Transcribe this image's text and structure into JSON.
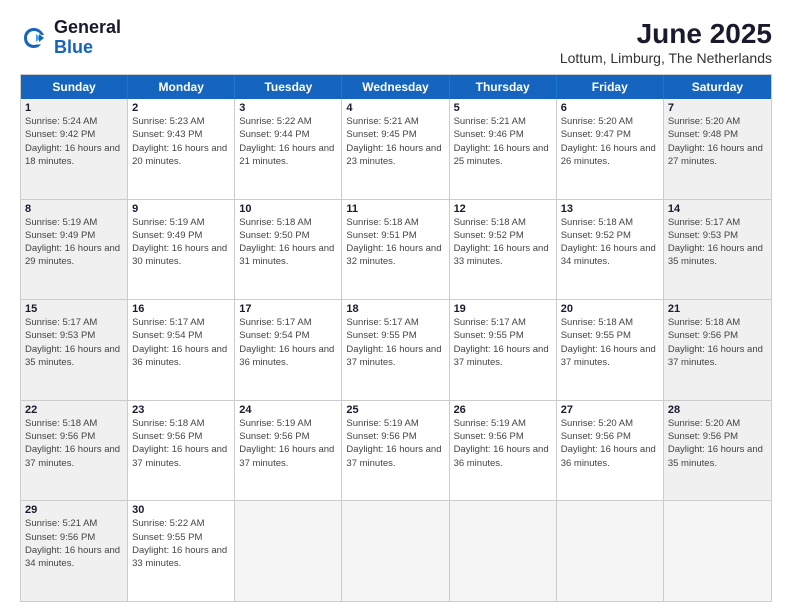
{
  "logo": {
    "general": "General",
    "blue": "Blue"
  },
  "title": "June 2025",
  "location": "Lottum, Limburg, The Netherlands",
  "days_of_week": [
    "Sunday",
    "Monday",
    "Tuesday",
    "Wednesday",
    "Thursday",
    "Friday",
    "Saturday"
  ],
  "weeks": [
    [
      {
        "day": 1,
        "sunrise": "Sunrise: 5:24 AM",
        "sunset": "Sunset: 9:42 PM",
        "daylight": "Daylight: 16 hours and 18 minutes."
      },
      {
        "day": 2,
        "sunrise": "Sunrise: 5:23 AM",
        "sunset": "Sunset: 9:43 PM",
        "daylight": "Daylight: 16 hours and 20 minutes."
      },
      {
        "day": 3,
        "sunrise": "Sunrise: 5:22 AM",
        "sunset": "Sunset: 9:44 PM",
        "daylight": "Daylight: 16 hours and 21 minutes."
      },
      {
        "day": 4,
        "sunrise": "Sunrise: 5:21 AM",
        "sunset": "Sunset: 9:45 PM",
        "daylight": "Daylight: 16 hours and 23 minutes."
      },
      {
        "day": 5,
        "sunrise": "Sunrise: 5:21 AM",
        "sunset": "Sunset: 9:46 PM",
        "daylight": "Daylight: 16 hours and 25 minutes."
      },
      {
        "day": 6,
        "sunrise": "Sunrise: 5:20 AM",
        "sunset": "Sunset: 9:47 PM",
        "daylight": "Daylight: 16 hours and 26 minutes."
      },
      {
        "day": 7,
        "sunrise": "Sunrise: 5:20 AM",
        "sunset": "Sunset: 9:48 PM",
        "daylight": "Daylight: 16 hours and 27 minutes."
      }
    ],
    [
      {
        "day": 8,
        "sunrise": "Sunrise: 5:19 AM",
        "sunset": "Sunset: 9:49 PM",
        "daylight": "Daylight: 16 hours and 29 minutes."
      },
      {
        "day": 9,
        "sunrise": "Sunrise: 5:19 AM",
        "sunset": "Sunset: 9:49 PM",
        "daylight": "Daylight: 16 hours and 30 minutes."
      },
      {
        "day": 10,
        "sunrise": "Sunrise: 5:18 AM",
        "sunset": "Sunset: 9:50 PM",
        "daylight": "Daylight: 16 hours and 31 minutes."
      },
      {
        "day": 11,
        "sunrise": "Sunrise: 5:18 AM",
        "sunset": "Sunset: 9:51 PM",
        "daylight": "Daylight: 16 hours and 32 minutes."
      },
      {
        "day": 12,
        "sunrise": "Sunrise: 5:18 AM",
        "sunset": "Sunset: 9:52 PM",
        "daylight": "Daylight: 16 hours and 33 minutes."
      },
      {
        "day": 13,
        "sunrise": "Sunrise: 5:18 AM",
        "sunset": "Sunset: 9:52 PM",
        "daylight": "Daylight: 16 hours and 34 minutes."
      },
      {
        "day": 14,
        "sunrise": "Sunrise: 5:17 AM",
        "sunset": "Sunset: 9:53 PM",
        "daylight": "Daylight: 16 hours and 35 minutes."
      }
    ],
    [
      {
        "day": 15,
        "sunrise": "Sunrise: 5:17 AM",
        "sunset": "Sunset: 9:53 PM",
        "daylight": "Daylight: 16 hours and 35 minutes."
      },
      {
        "day": 16,
        "sunrise": "Sunrise: 5:17 AM",
        "sunset": "Sunset: 9:54 PM",
        "daylight": "Daylight: 16 hours and 36 minutes."
      },
      {
        "day": 17,
        "sunrise": "Sunrise: 5:17 AM",
        "sunset": "Sunset: 9:54 PM",
        "daylight": "Daylight: 16 hours and 36 minutes."
      },
      {
        "day": 18,
        "sunrise": "Sunrise: 5:17 AM",
        "sunset": "Sunset: 9:55 PM",
        "daylight": "Daylight: 16 hours and 37 minutes."
      },
      {
        "day": 19,
        "sunrise": "Sunrise: 5:17 AM",
        "sunset": "Sunset: 9:55 PM",
        "daylight": "Daylight: 16 hours and 37 minutes."
      },
      {
        "day": 20,
        "sunrise": "Sunrise: 5:18 AM",
        "sunset": "Sunset: 9:55 PM",
        "daylight": "Daylight: 16 hours and 37 minutes."
      },
      {
        "day": 21,
        "sunrise": "Sunrise: 5:18 AM",
        "sunset": "Sunset: 9:56 PM",
        "daylight": "Daylight: 16 hours and 37 minutes."
      }
    ],
    [
      {
        "day": 22,
        "sunrise": "Sunrise: 5:18 AM",
        "sunset": "Sunset: 9:56 PM",
        "daylight": "Daylight: 16 hours and 37 minutes."
      },
      {
        "day": 23,
        "sunrise": "Sunrise: 5:18 AM",
        "sunset": "Sunset: 9:56 PM",
        "daylight": "Daylight: 16 hours and 37 minutes."
      },
      {
        "day": 24,
        "sunrise": "Sunrise: 5:19 AM",
        "sunset": "Sunset: 9:56 PM",
        "daylight": "Daylight: 16 hours and 37 minutes."
      },
      {
        "day": 25,
        "sunrise": "Sunrise: 5:19 AM",
        "sunset": "Sunset: 9:56 PM",
        "daylight": "Daylight: 16 hours and 37 minutes."
      },
      {
        "day": 26,
        "sunrise": "Sunrise: 5:19 AM",
        "sunset": "Sunset: 9:56 PM",
        "daylight": "Daylight: 16 hours and 36 minutes."
      },
      {
        "day": 27,
        "sunrise": "Sunrise: 5:20 AM",
        "sunset": "Sunset: 9:56 PM",
        "daylight": "Daylight: 16 hours and 36 minutes."
      },
      {
        "day": 28,
        "sunrise": "Sunrise: 5:20 AM",
        "sunset": "Sunset: 9:56 PM",
        "daylight": "Daylight: 16 hours and 35 minutes."
      }
    ],
    [
      {
        "day": 29,
        "sunrise": "Sunrise: 5:21 AM",
        "sunset": "Sunset: 9:56 PM",
        "daylight": "Daylight: 16 hours and 34 minutes."
      },
      {
        "day": 30,
        "sunrise": "Sunrise: 5:22 AM",
        "sunset": "Sunset: 9:55 PM",
        "daylight": "Daylight: 16 hours and 33 minutes."
      },
      null,
      null,
      null,
      null,
      null
    ]
  ]
}
